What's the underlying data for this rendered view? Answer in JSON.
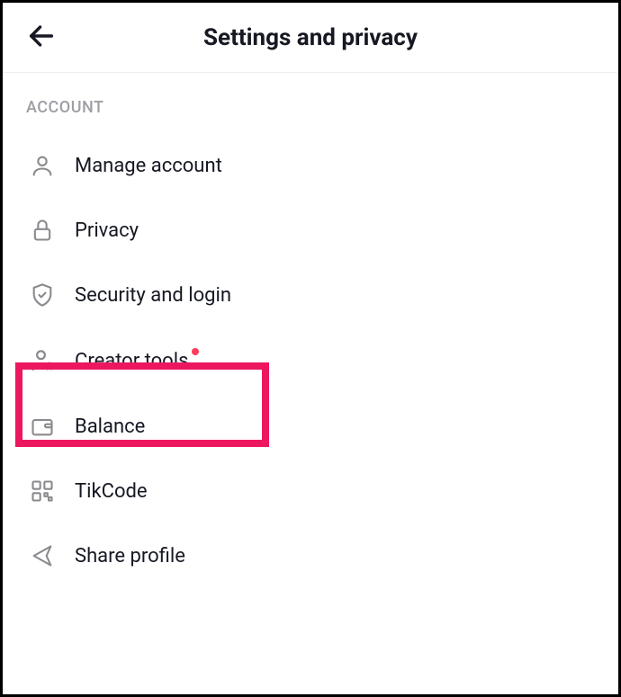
{
  "header": {
    "title": "Settings and privacy"
  },
  "section": {
    "label": "ACCOUNT",
    "items": [
      {
        "label": "Manage account"
      },
      {
        "label": "Privacy"
      },
      {
        "label": "Security and login"
      },
      {
        "label": "Creator tools"
      },
      {
        "label": "Balance"
      },
      {
        "label": "TikCode"
      },
      {
        "label": "Share profile"
      }
    ]
  }
}
